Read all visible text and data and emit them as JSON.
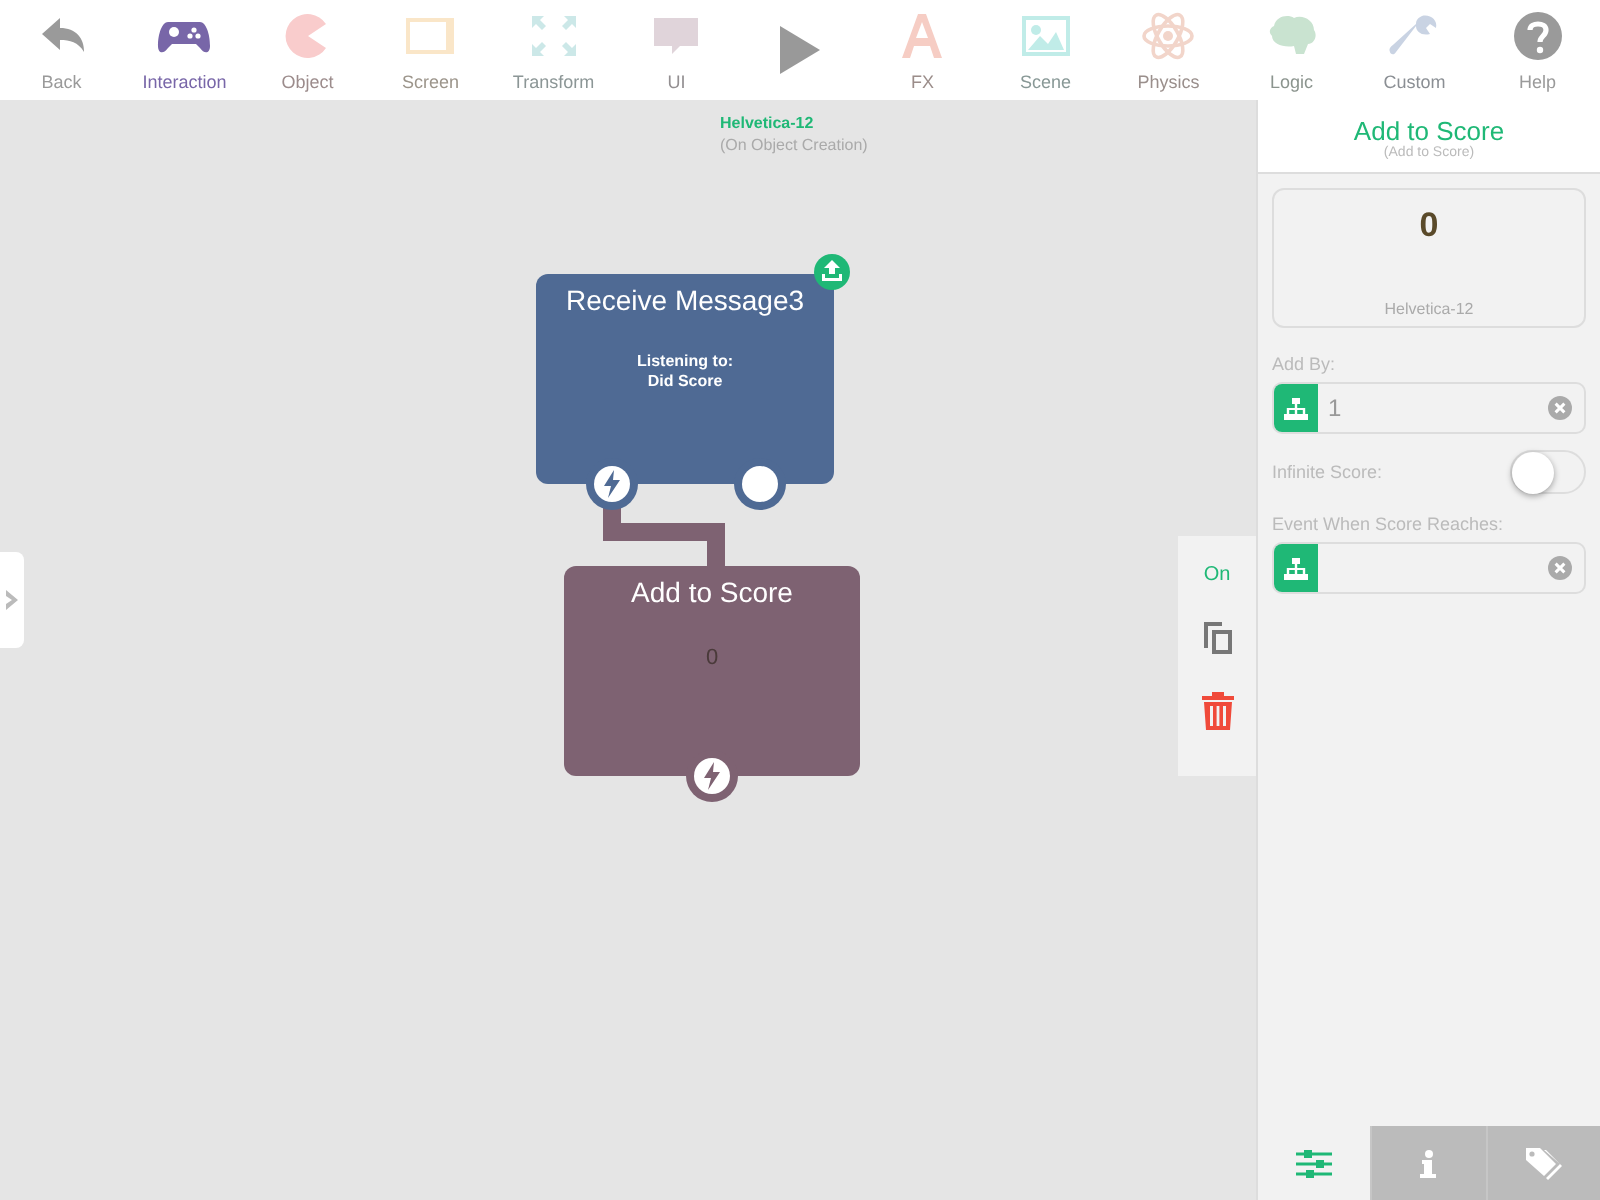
{
  "toolbar": {
    "items": [
      {
        "label": "Back",
        "kind": "action",
        "color": "#9a9a9a"
      },
      {
        "label": "Interaction",
        "kind": "category",
        "color": "#7866a8",
        "selected": true
      },
      {
        "label": "Object",
        "kind": "category",
        "color": "#f9cccc",
        "selected": false
      },
      {
        "label": "Screen",
        "kind": "category",
        "color": "#fae6c8",
        "selected": false
      },
      {
        "label": "Transform",
        "kind": "category",
        "color": "#cce8e8",
        "selected": false
      },
      {
        "label": "UI",
        "kind": "category",
        "color": "#e0d4da",
        "selected": false
      },
      {
        "label": "FX",
        "kind": "category",
        "color": "#f6cdc4",
        "selected": false
      },
      {
        "label": "Scene",
        "kind": "category",
        "color": "#c0ece8",
        "selected": false
      },
      {
        "label": "Physics",
        "kind": "category",
        "color": "#f2d5ca",
        "selected": false
      },
      {
        "label": "Logic",
        "kind": "category",
        "color": "#c9e3d0",
        "selected": false
      },
      {
        "label": "Custom",
        "kind": "category",
        "color": "#c9d3e3",
        "selected": false
      },
      {
        "label": "Help",
        "kind": "action",
        "color": "#9a9a9a"
      }
    ]
  },
  "canvas": {
    "object_name": "Helvetica-12",
    "event": "(On Object Creation)",
    "nodes": [
      {
        "title": "Receive Message3",
        "lines": [
          "Listening to:",
          "Did Score"
        ],
        "color": "#4f6a94",
        "badge": true,
        "ports": [
          {
            "kind": "trigger"
          },
          {
            "kind": "circle"
          }
        ]
      },
      {
        "title": "Add to Score",
        "lines": [
          "0"
        ],
        "color": "#7e6272",
        "badge": false,
        "ports": [
          {
            "kind": "trigger"
          }
        ]
      }
    ],
    "actions": {
      "toggle_label": "On"
    }
  },
  "panel": {
    "title": "Add to Score",
    "subtitle": "(Add to Score)",
    "preview": {
      "value": "0",
      "caption": "Helvetica-12"
    },
    "fields": [
      {
        "kind": "input",
        "label": "Add By:",
        "value": "1"
      },
      {
        "kind": "switch",
        "label": "Infinite Score:",
        "on": false
      },
      {
        "kind": "input",
        "label": "Event When Score Reaches:"
      }
    ],
    "tabs": [
      {
        "selected": true
      },
      {
        "selected": false
      },
      {
        "selected": false
      }
    ]
  }
}
